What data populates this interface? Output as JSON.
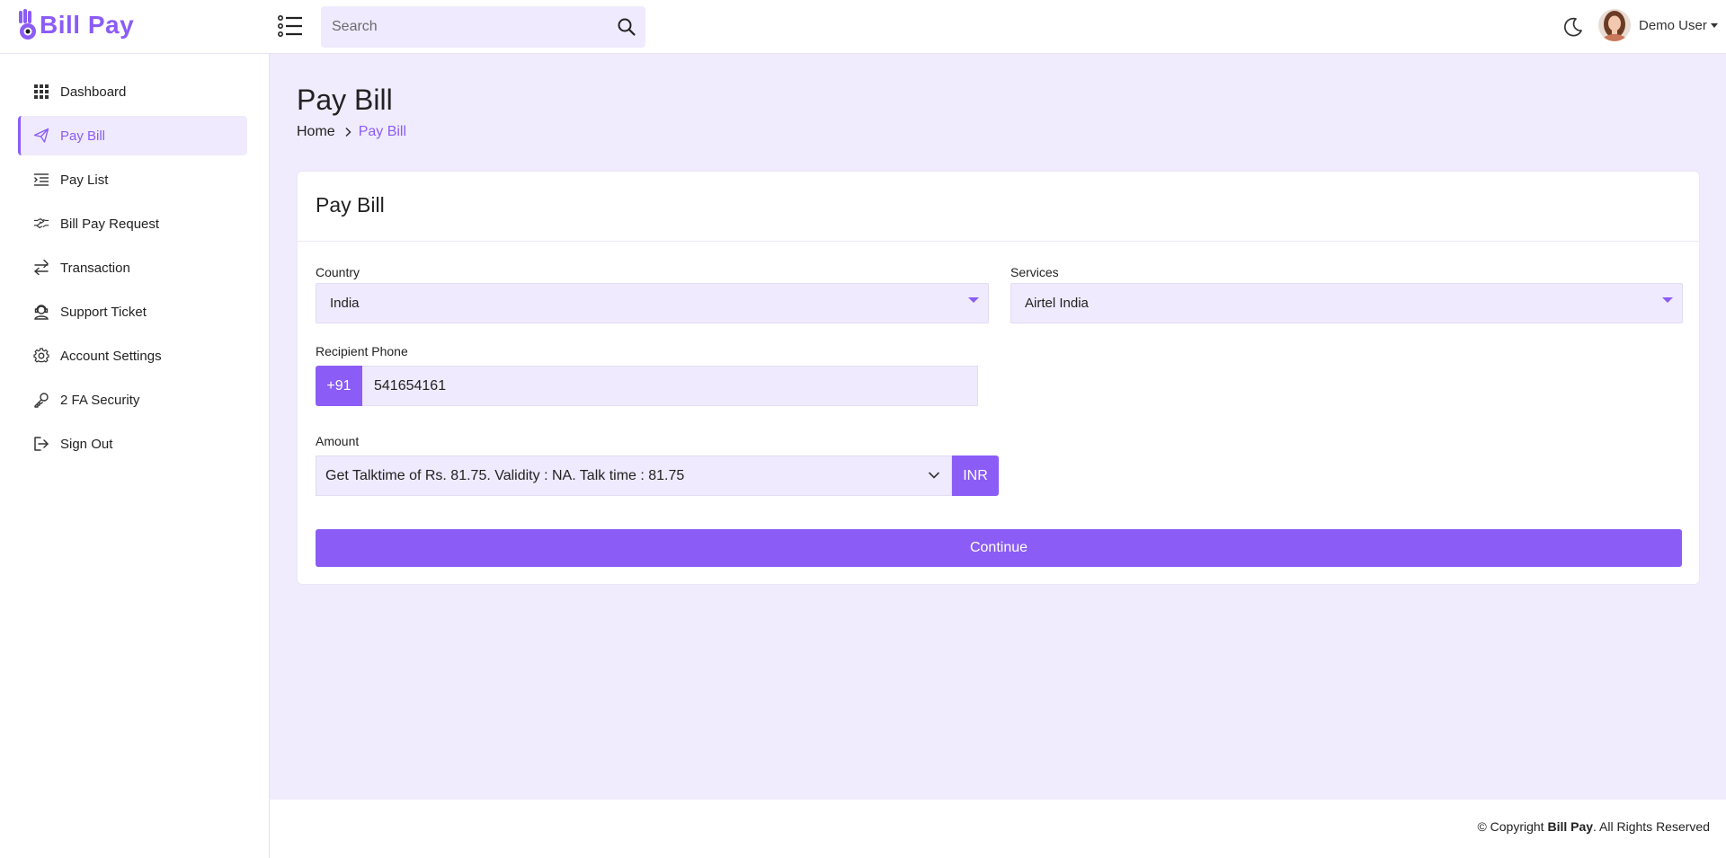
{
  "brand": {
    "name": "Bill Pay",
    "accent": "#8b5cf6",
    "light_bg": "#f0ecfd"
  },
  "header": {
    "search_placeholder": "Search",
    "user_name": "Demo User",
    "icons": {
      "menu": "list-menu-icon",
      "search": "search-icon",
      "theme": "moon-icon"
    }
  },
  "sidebar": {
    "items": [
      {
        "label": "Dashboard",
        "icon": "grid-icon",
        "active": false
      },
      {
        "label": "Pay Bill",
        "icon": "send-icon",
        "active": true
      },
      {
        "label": "Pay List",
        "icon": "list-indent-icon",
        "active": false
      },
      {
        "label": "Bill Pay Request",
        "icon": "handshake-icon",
        "active": false
      },
      {
        "label": "Transaction",
        "icon": "arrows-exchange-icon",
        "active": false
      },
      {
        "label": "Support Ticket",
        "icon": "support-icon",
        "active": false
      },
      {
        "label": "Account Settings",
        "icon": "gear-icon",
        "active": false
      },
      {
        "label": "2 FA Security",
        "icon": "key-icon",
        "active": false
      },
      {
        "label": "Sign Out",
        "icon": "sign-out-icon",
        "active": false
      }
    ]
  },
  "page": {
    "title": "Pay Bill",
    "breadcrumb": {
      "home": "Home",
      "current": "Pay Bill"
    }
  },
  "form": {
    "card_title": "Pay Bill",
    "country": {
      "label": "Country",
      "value": "India"
    },
    "services": {
      "label": "Services",
      "value": "Airtel India"
    },
    "phone": {
      "label": "Recipient Phone",
      "prefix": "+91",
      "value": "541654161"
    },
    "amount": {
      "label": "Amount",
      "value": "Get Talktime of Rs. 81.75. Validity : NA. Talk time : 81.75",
      "currency": "INR"
    },
    "continue_label": "Continue"
  },
  "footer": {
    "copyright_prefix": "© Copyright ",
    "brand": "Bill Pay",
    "copyright_suffix": ". All Rights Reserved"
  }
}
